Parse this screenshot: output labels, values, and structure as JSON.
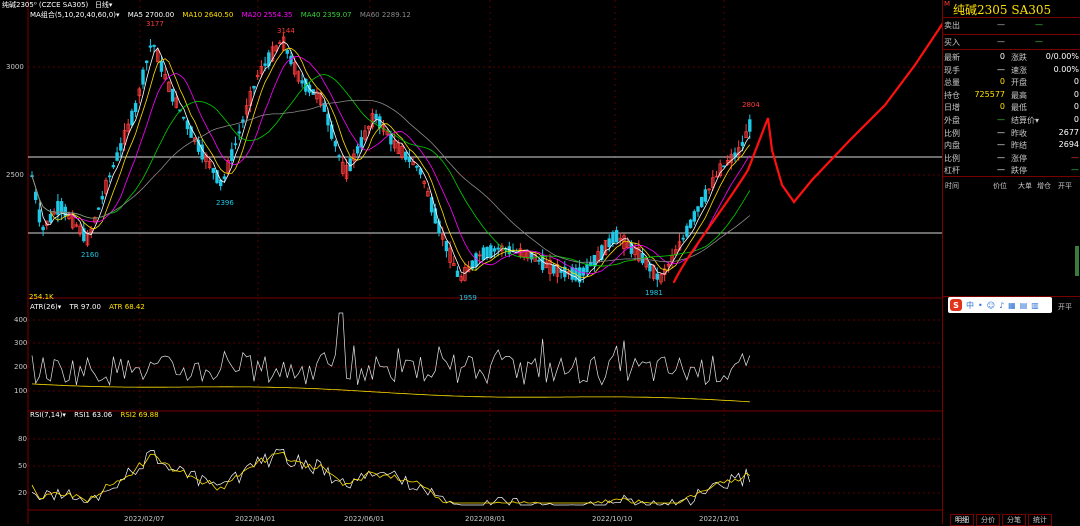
{
  "topbar": {
    "title": "纯碱2305⁰ (CZCE SA305)",
    "period": "日线▾"
  },
  "ma_legend": {
    "name": "MA组合(5,10,20,40,60,0)▾",
    "ma5": "MA5 2700.00",
    "ma10": "MA10 2640.50",
    "ma20": "MA20 2554.35",
    "ma40": "MA40 2359.07",
    "ma60": "MA60 2289.12"
  },
  "price_axis": [
    "3000",
    "2500"
  ],
  "price_labels": {
    "h1": "3177",
    "h2": "3144",
    "h3": "2804",
    "l1": "2396",
    "l2": "2160",
    "l3": "1959",
    "l4": "1981"
  },
  "volume_note": "254.1K",
  "atr_legend": {
    "name": "ATR(26)▾",
    "tr": "TR 97.00",
    "atr": "ATR 68.42"
  },
  "atr_axis": [
    "400",
    "300",
    "200",
    "100"
  ],
  "rsi_legend": {
    "name": "RSI(7,14)▾",
    "rsi1": "RSI1 63.06",
    "rsi2": "RSI2 69.88"
  },
  "rsi_axis": [
    "80",
    "50",
    "20"
  ],
  "dates": [
    "2022/02/07",
    "2022/04/01",
    "2022/06/01",
    "2022/08/01",
    "2022/10/10",
    "2022/12/01"
  ],
  "panel": {
    "title": "纯碱2305  SA305",
    "sell": "卖出",
    "buy": "买入",
    "dash": "—",
    "rows": [
      {
        "l": "最新",
        "v": "0",
        "l2": "涨跌",
        "v2": "0/0.00%"
      },
      {
        "l": "现手",
        "v": "—",
        "l2": "速涨",
        "v2": "0.00%"
      },
      {
        "l": "总量",
        "v": "0",
        "l2": "开盘",
        "v2": "0"
      },
      {
        "l": "持仓",
        "v": "725577",
        "l2": "最高",
        "v2": "0"
      },
      {
        "l": "日增",
        "v": "0",
        "l2": "最低",
        "v2": "0"
      },
      {
        "l": "外盘",
        "v": "—",
        "l2": "结算价▾",
        "v2": "0"
      },
      {
        "l": "比例",
        "v": "—",
        "l2": "昨收",
        "v2": "2677"
      },
      {
        "l": "内盘",
        "v": "—",
        "l2": "昨结",
        "v2": "2694"
      },
      {
        "l": "比例",
        "v": "—",
        "l2": "涨停",
        "v2": "—"
      },
      {
        "l": "杠杆",
        "v": "—",
        "l2": "跌停",
        "v2": "—"
      }
    ],
    "headers": [
      "时间",
      "价位",
      "大单",
      "增仓",
      "开平"
    ],
    "open_label": "开平",
    "ime": "中",
    "tabs": [
      "明细",
      "分价",
      "分笔",
      "统计"
    ]
  },
  "colors": {
    "up": "#ff3b3b",
    "down": "#1ec8e6",
    "ma5": "#ffffff",
    "ma10": "#ffe000",
    "ma20": "#ff00ff",
    "ma40": "#00d000",
    "ma60": "#8a8a8a",
    "sketch": "#ff1010"
  }
}
